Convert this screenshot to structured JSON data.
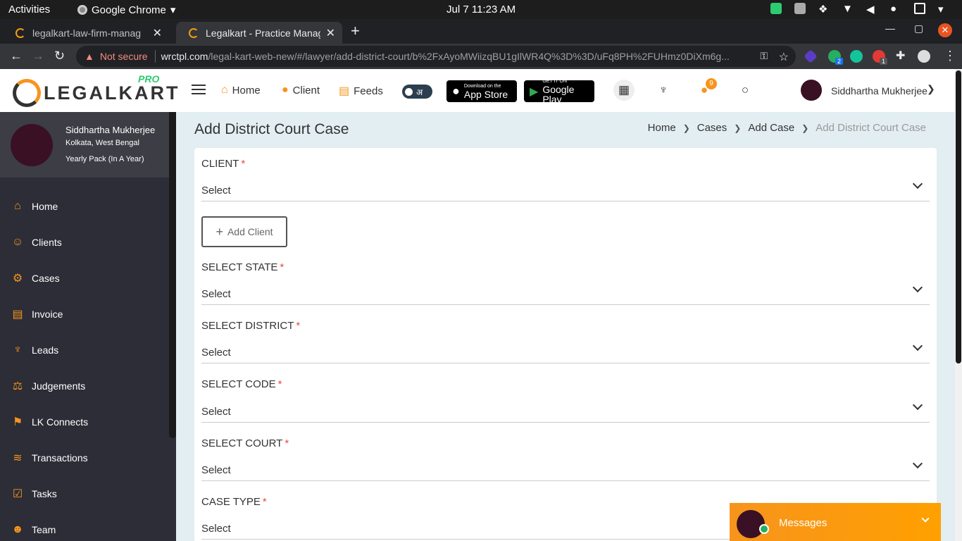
{
  "os": {
    "activities": "Activities",
    "app_name": "Google Chrome",
    "clock": "Jul 7  11:23 AM"
  },
  "browser": {
    "tabs": [
      {
        "label": "legalkart-law-firm-manag"
      },
      {
        "label": "Legalkart - Practice Manag"
      }
    ],
    "security_label": "Not secure",
    "url_host": "wrctpl.com",
    "url_path": "/legal-kart-web-new/#/lawyer/add-district-court/b%2FxAyoMWiizqBU1gIlWR4Q%3D%3D/uFq8PH%2FUHmz0DiXm6g...",
    "extension_badges": [
      "2",
      "1"
    ]
  },
  "header": {
    "logo_text_a": "LEGALKART",
    "logo_pro": "PRO",
    "nav": [
      {
        "label": "Home",
        "icon": "home-icon"
      },
      {
        "label": "Client",
        "icon": "client-icon"
      },
      {
        "label": "Feeds",
        "icon": "feeds-icon"
      }
    ],
    "lang_toggle": "अ",
    "app_store": {
      "small": "Download on the",
      "big": "App Store"
    },
    "google_play": {
      "small": "GET IT ON",
      "big": "Google Play"
    },
    "notification_count": "9",
    "user_name": "Siddhartha Mukherjee"
  },
  "sidebar": {
    "profile": {
      "name": "Siddhartha Mukherjee",
      "location": "Kolkata, West Bengal",
      "plan": "Yearly Pack (In A Year)"
    },
    "items": [
      {
        "label": "Home",
        "icon": "⌂"
      },
      {
        "label": "Clients",
        "icon": "☺"
      },
      {
        "label": "Cases",
        "icon": "⚙"
      },
      {
        "label": "Invoice",
        "icon": "▤"
      },
      {
        "label": "Leads",
        "icon": "♆"
      },
      {
        "label": "Judgements",
        "icon": "⚖"
      },
      {
        "label": "LK Connects",
        "icon": "⚑"
      },
      {
        "label": "Transactions",
        "icon": "≋"
      },
      {
        "label": "Tasks",
        "icon": "☑"
      },
      {
        "label": "Team",
        "icon": "☻"
      }
    ]
  },
  "main": {
    "title": "Add District Court Case",
    "breadcrumb": [
      "Home",
      "Cases",
      "Add Case",
      "Add District Court Case"
    ],
    "fields": [
      {
        "label": "CLIENT",
        "value": "Select"
      },
      {
        "label": "SELECT STATE",
        "value": "Select"
      },
      {
        "label": "SELECT DISTRICT",
        "value": "Select"
      },
      {
        "label": "SELECT CODE",
        "value": "Select"
      },
      {
        "label": "SELECT COURT",
        "value": "Select"
      },
      {
        "label": "CASE TYPE",
        "value": "Select"
      }
    ],
    "add_client_label": "Add Client",
    "required_mark": "*"
  },
  "messages": {
    "label": "Messages"
  }
}
